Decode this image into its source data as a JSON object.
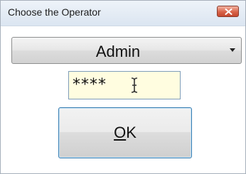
{
  "window": {
    "title": "Choose the Operator"
  },
  "operator_select": {
    "value": "Admin"
  },
  "password_field": {
    "value": "****"
  },
  "ok_button": {
    "mnemonic": "O",
    "rest": "K"
  }
}
